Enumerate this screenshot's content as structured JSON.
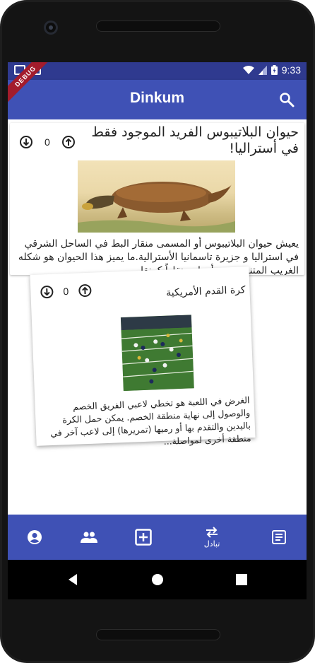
{
  "status_bar": {
    "time": "9:33",
    "debug_banner": "DEBUG"
  },
  "app_bar": {
    "title": "Dinkum",
    "search_icon": "search-icon"
  },
  "posts": [
    {
      "title": "حيوان البلاتيبوس الفريد الموجود فقط في أستراليا!",
      "vote_count": "0",
      "excerpt": "يعيش حيوان البلاتيبوس أو المسمى منقار البط في الساحل الشرقي في استراليا و جزيرة تاسمانيا الأسترالية.ما يميز هذا الحيوان هو شكله الغريب المتنوع حيث أن له منقاراً كمنقا..."
    },
    {
      "title": "كرة القدم الأمريكية",
      "vote_count": "0",
      "excerpt": "الغرض في اللعبة هو تخطي لاعبي الفريق الخصم والوصول إلى نهاية منطقة الخصم. يمكن حمل الكرة باليدين والتقدم بها أو رميها (تمريرها) إلى لاعب آخر في منطقة أخرى لمواصلة..."
    }
  ],
  "bottom_nav": {
    "items": [
      {
        "icon": "account-circle-icon",
        "label": ""
      },
      {
        "icon": "people-icon",
        "label": ""
      },
      {
        "icon": "add-box-icon",
        "label": ""
      },
      {
        "icon": "swap-horiz-icon",
        "label": "تبادل"
      },
      {
        "icon": "article-icon",
        "label": ""
      }
    ]
  },
  "system_nav": {
    "icons": [
      "back-icon",
      "home-icon",
      "recents-icon"
    ]
  },
  "colors": {
    "primary": "#3f51b5",
    "status_bar": "#2f3a8f",
    "debug_ribbon": "#a31c2c"
  }
}
